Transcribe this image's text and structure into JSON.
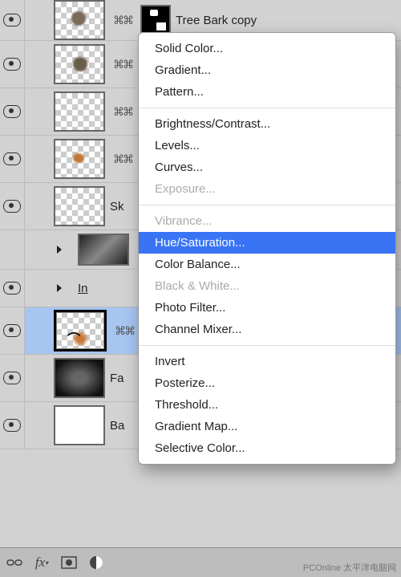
{
  "layers": {
    "l0": "Tree Bark copy",
    "l4": "Sk",
    "l6": "In",
    "l8": "Fa",
    "l9": "Ba"
  },
  "link_glyph": "⌘⌘",
  "menu": {
    "solid_color": "Solid Color...",
    "gradient": "Gradient...",
    "pattern": "Pattern...",
    "brightness": "Brightness/Contrast...",
    "levels": "Levels...",
    "curves": "Curves...",
    "exposure": "Exposure...",
    "vibrance": "Vibrance...",
    "hue_sat": "Hue/Saturation...",
    "color_balance": "Color Balance...",
    "black_white": "Black & White...",
    "photo_filter": "Photo Filter...",
    "channel_mixer": "Channel Mixer...",
    "invert": "Invert",
    "posterize": "Posterize...",
    "threshold": "Threshold...",
    "gradient_map": "Gradient Map...",
    "selective_color": "Selective Color..."
  },
  "footer_icons": [
    "link",
    "fx",
    "mask",
    "adjustment"
  ],
  "watermark": "PCOnline 太平洋电脑网"
}
